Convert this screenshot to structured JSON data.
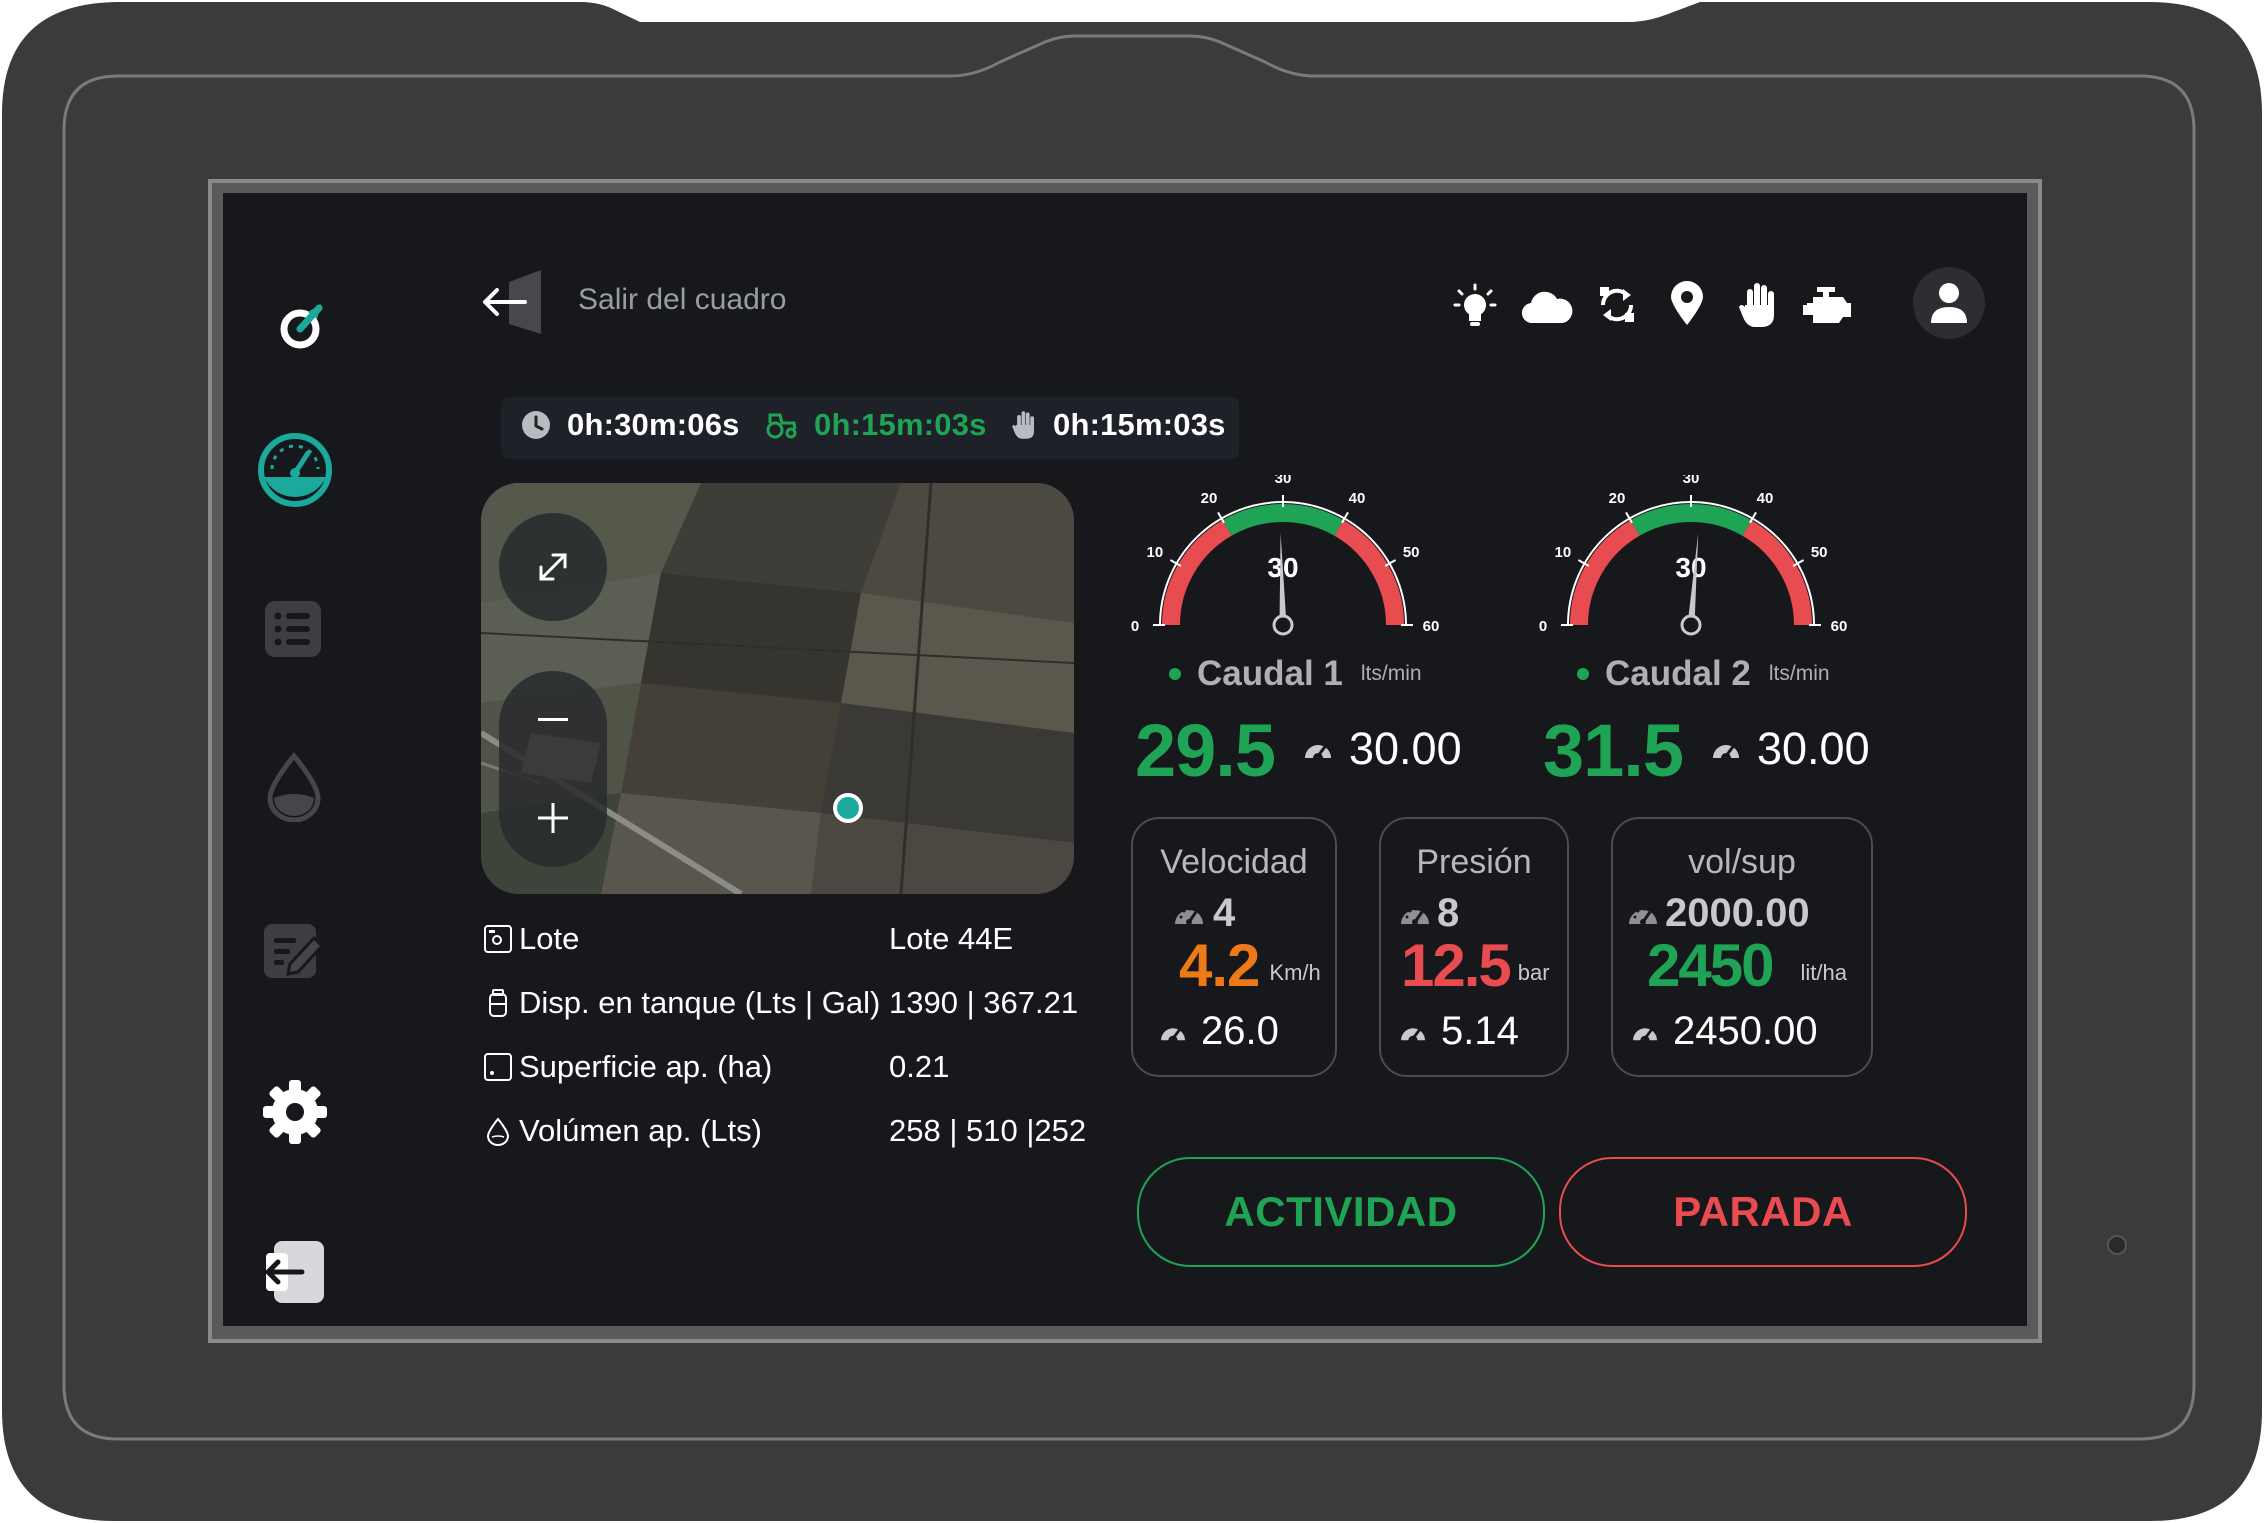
{
  "header": {
    "exit_label": "Salir del cuadro"
  },
  "status_icons": [
    "light-bulb-icon",
    "cloud-icon",
    "sync-icon",
    "location-pin-icon",
    "hand-stop-icon",
    "engine-icon",
    "user-avatar-icon"
  ],
  "timers": [
    {
      "icon": "clock-icon",
      "value": "0h:30m:06s",
      "color": "#ffffff"
    },
    {
      "icon": "tractor-icon",
      "value": "0h:15m:03s",
      "color": "#1fa455"
    },
    {
      "icon": "hand-icon",
      "value": "0h:15m:03s",
      "color": "#ffffff"
    }
  ],
  "sidebar": {
    "items": [
      {
        "name": "logo",
        "icon": "brand-logo-icon"
      },
      {
        "name": "dashboard",
        "icon": "gauge-icon",
        "active": true
      },
      {
        "name": "list",
        "icon": "list-icon"
      },
      {
        "name": "fluid",
        "icon": "drop-icon"
      },
      {
        "name": "notes",
        "icon": "edit-icon"
      },
      {
        "name": "settings",
        "icon": "gear-icon"
      },
      {
        "name": "logout",
        "icon": "logout-icon"
      }
    ]
  },
  "map": {
    "buttons": [
      "expand-icon",
      "zoom-out-icon",
      "zoom-in-icon"
    ]
  },
  "info": {
    "lote_label": "Lote",
    "lote_value": "Lote 44E",
    "tank_label": "Disp. en tanque (Lts | Gal)",
    "tank_value": "1390 | 367.21",
    "surface_label": "Superficie ap. (ha)",
    "surface_value": "0.21",
    "volume_label": "Volúmen ap. (Lts)",
    "volume_value": "258 | 510 |252"
  },
  "caudal1": {
    "title": "Caudal 1",
    "unit": "lts/min",
    "value": "29.5",
    "target": "30.00",
    "gauge_center_label": "30",
    "needle_value": 29.5
  },
  "caudal2": {
    "title": "Caudal 2",
    "unit": "lts/min",
    "value": "31.5",
    "target": "30.00",
    "gauge_center_label": "30",
    "needle_value": 31.5
  },
  "gauge_ticks": [
    "0",
    "10",
    "20",
    "30",
    "40",
    "50",
    "60"
  ],
  "gauge_range": [
    0,
    60
  ],
  "gauge_green_range": [
    20,
    40
  ],
  "cards": {
    "velocidad": {
      "title": "Velocidad",
      "set": "4",
      "value": "4.2",
      "unit": "Km/h",
      "target": "26.0",
      "value_color": "#ee7a17"
    },
    "presion": {
      "title": "Presión",
      "set": "8",
      "value": "12.5",
      "unit": "bar",
      "target": "5.14",
      "value_color": "#e84b50"
    },
    "volsup": {
      "title": "vol/sup",
      "set": "2000.00",
      "value": "2450",
      "unit": "lit/ha",
      "target": "2450.00",
      "value_color": "#1fa455"
    }
  },
  "actions": {
    "actividad": "ACTIVIDAD",
    "parada": "PARADA"
  },
  "colors": {
    "accent": "#1fa455",
    "teal": "#1aa99b",
    "danger": "#e84b50",
    "warning": "#ee7a17",
    "screen_bg": "#17181c",
    "device": "#3b3b3b"
  }
}
